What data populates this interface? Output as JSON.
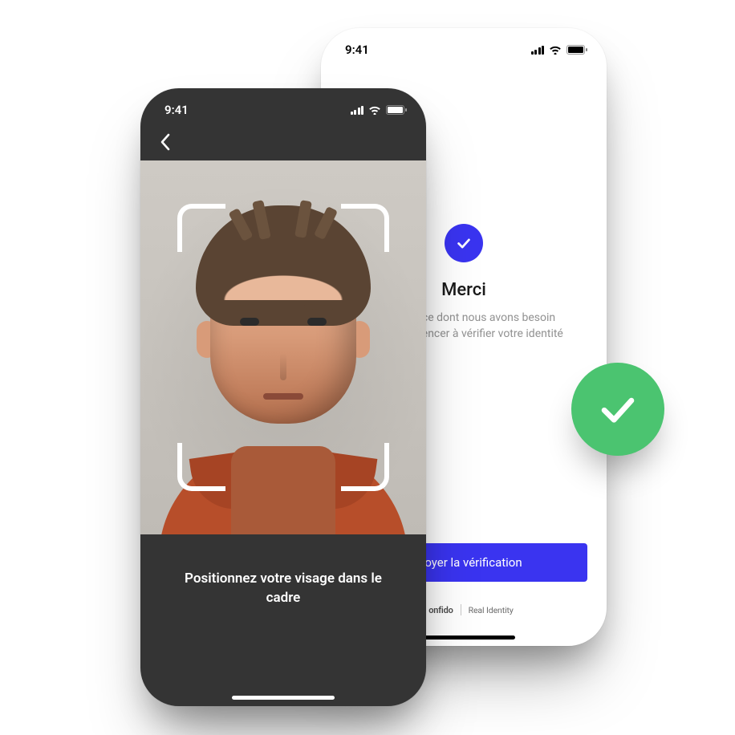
{
  "colors": {
    "primary": "#3a34f0",
    "success": "#4bc470",
    "darkPhoneBg": "#343434"
  },
  "status": {
    "time": "9:41"
  },
  "confirm": {
    "title": "Merci",
    "subtitle": "C'est tout ce dont nous avons besoin pour commencer à vérifier votre identité",
    "submit_label": "Envoyer la vérification"
  },
  "brand": {
    "name": "onfido",
    "tagline": "Real Identity"
  },
  "capture": {
    "instruction": "Positionnez votre visage dans le cadre"
  },
  "badge": {
    "name": "verification-success"
  }
}
